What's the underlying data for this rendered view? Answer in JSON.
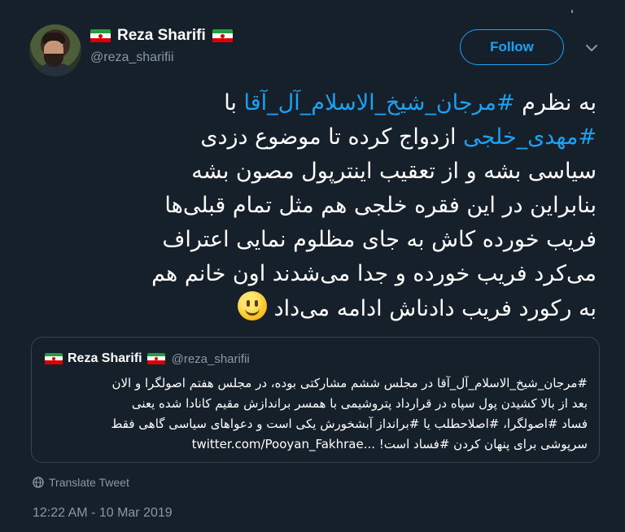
{
  "author": {
    "display_name": "Reza Sharifi",
    "handle": "@reza_sharifii"
  },
  "follow_button": {
    "label": "Follow"
  },
  "colors": {
    "background": "#15202b",
    "accent": "#1da1f2",
    "muted": "#8899a6",
    "border": "#38444d"
  },
  "icons": {
    "menu": "chevron-down-icon",
    "translate": "globe-icon",
    "emoji": "smiling-face-emoji",
    "flag": "iran-flag-emoji"
  },
  "tweet": {
    "line1_pre": "به نظرم ",
    "line1_tag": "#مرجان_شیخ_الاسلام_آل_آقا",
    "line1_post": " با",
    "line2_tag": "#مهدی_خلجی",
    "line2_post": " ازدواج کرده تا موضوع دزدی",
    "line3": "سیاسی بشه و از تعقیب اینترپول مصون بشه",
    "line4": "بنابراین در این فقره خلجی هم مثل تمام قبلی‌ها",
    "line5": "فریب خورده کاش به جای مظلوم نمایی اعتراف",
    "line6": "می‌کرد فریب خورده و جدا می‌شدند اون خانم هم",
    "line7": "به رکورد فریب دادناش ادامه می‌داد"
  },
  "quoted_tweet": {
    "display_name": "Reza Sharifi",
    "handle": "@reza_sharifii",
    "line1": "#مرجان_شیخ_الاسلام_آل_آقا در مجلس ششم مشارکتی بوده، در مجلس هفتم اصولگرا و الان",
    "line2": "بعد از بالا کشیدن پول سپاه در قرارداد پتروشیمی با همسر براندازش مقیم کانادا شده یعنی",
    "line3": "فساد #اصولگرا، #اصلاحطلب یا #برانداز آبشخورش یکی است و دعواهای سیاسی گاهی فقط",
    "line4": "سرپوشی برای پنهان کردن #فساد است! ...twitter.com/Pooyan_Fakhrae"
  },
  "translate_label": "Translate Tweet",
  "timestamp": "12:22 AM - 10 Mar 2019"
}
